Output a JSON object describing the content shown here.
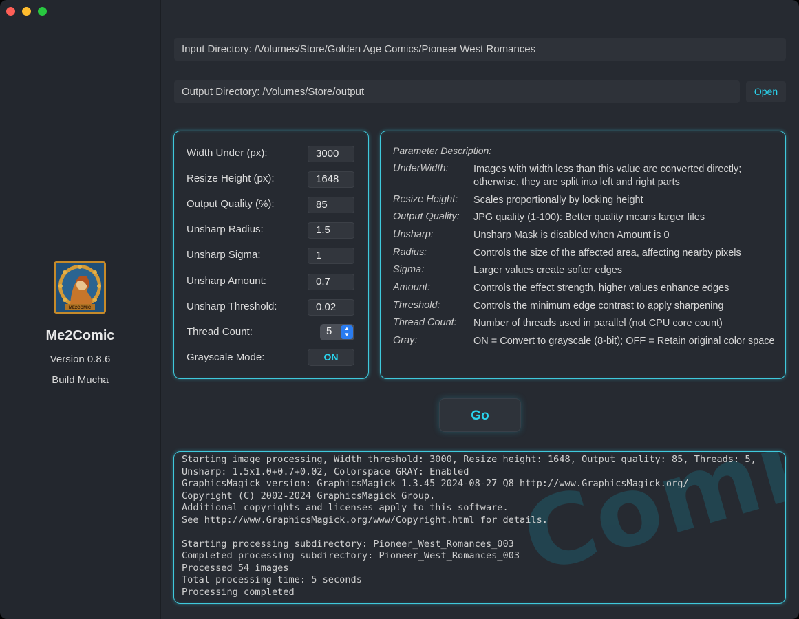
{
  "app": {
    "name": "Me2Comic",
    "version": "Version 0.8.6",
    "build": "Build Mucha",
    "logo_label": "ME2COMIC"
  },
  "directories": {
    "input": "Input Directory: /Volumes/Store/Golden Age Comics/Pioneer West Romances",
    "output": "Output Directory: /Volumes/Store/output",
    "open_label": "Open"
  },
  "params": [
    {
      "label": "Width Under (px):",
      "value": "3000"
    },
    {
      "label": "Resize Height (px):",
      "value": "1648"
    },
    {
      "label": "Output Quality (%):",
      "value": "85"
    },
    {
      "label": "Unsharp Radius:",
      "value": "1.5"
    },
    {
      "label": "Unsharp Sigma:",
      "value": "1"
    },
    {
      "label": "Unsharp Amount:",
      "value": "0.7"
    },
    {
      "label": "Unsharp Threshold:",
      "value": "0.02"
    }
  ],
  "thread": {
    "label": "Thread Count:",
    "value": "5"
  },
  "grayscale": {
    "label": "Grayscale Mode:",
    "value": "ON"
  },
  "description": {
    "title": "Parameter Description:",
    "items": [
      {
        "key": "UnderWidth:",
        "text": "Images with width less than this value are converted directly; otherwise, they are split into left and right parts"
      },
      {
        "key": "Resize Height:",
        "text": "Scales proportionally by locking height"
      },
      {
        "key": "Output Quality:",
        "text": "JPG quality (1-100): Better quality means larger files"
      },
      {
        "key": "Unsharp:",
        "text": "Unsharp Mask is disabled when Amount is 0"
      },
      {
        "key": "Radius:",
        "text": "Controls the size of the affected area, affecting nearby pixels"
      },
      {
        "key": "Sigma:",
        "text": "Larger values create softer edges"
      },
      {
        "key": "Amount:",
        "text": "Controls the effect strength, higher values enhance edges"
      },
      {
        "key": "Threshold:",
        "text": "Controls the minimum edge contrast to apply sharpening"
      },
      {
        "key": "Thread Count:",
        "text": "Number of threads used in parallel (not CPU core count)"
      },
      {
        "key": "Gray:",
        "text": "ON = Convert to grayscale (8-bit); OFF = Retain original color space"
      }
    ]
  },
  "go_label": "Go",
  "log": {
    "text": "Starting image processing, Width threshold: 3000, Resize height: 1648, Output quality: 85, Threads: 5, Unsharp: 1.5x1.0+0.7+0.02, Colorspace GRAY: Enabled\nGraphicsMagick version: GraphicsMagick 1.3.45 2024-08-27 Q8 http://www.GraphicsMagick.org/\nCopyright (C) 2002-2024 GraphicsMagick Group.\nAdditional copyrights and licenses apply to this software.\nSee http://www.GraphicsMagick.org/www/Copyright.html for details.\n\nStarting processing subdirectory: Pioneer_West_Romances_003\nCompleted processing subdirectory: Pioneer_West_Romances_003\nProcessed 54 images\nTotal processing time: 5 seconds\nProcessing completed",
    "watermark": "Comic"
  }
}
